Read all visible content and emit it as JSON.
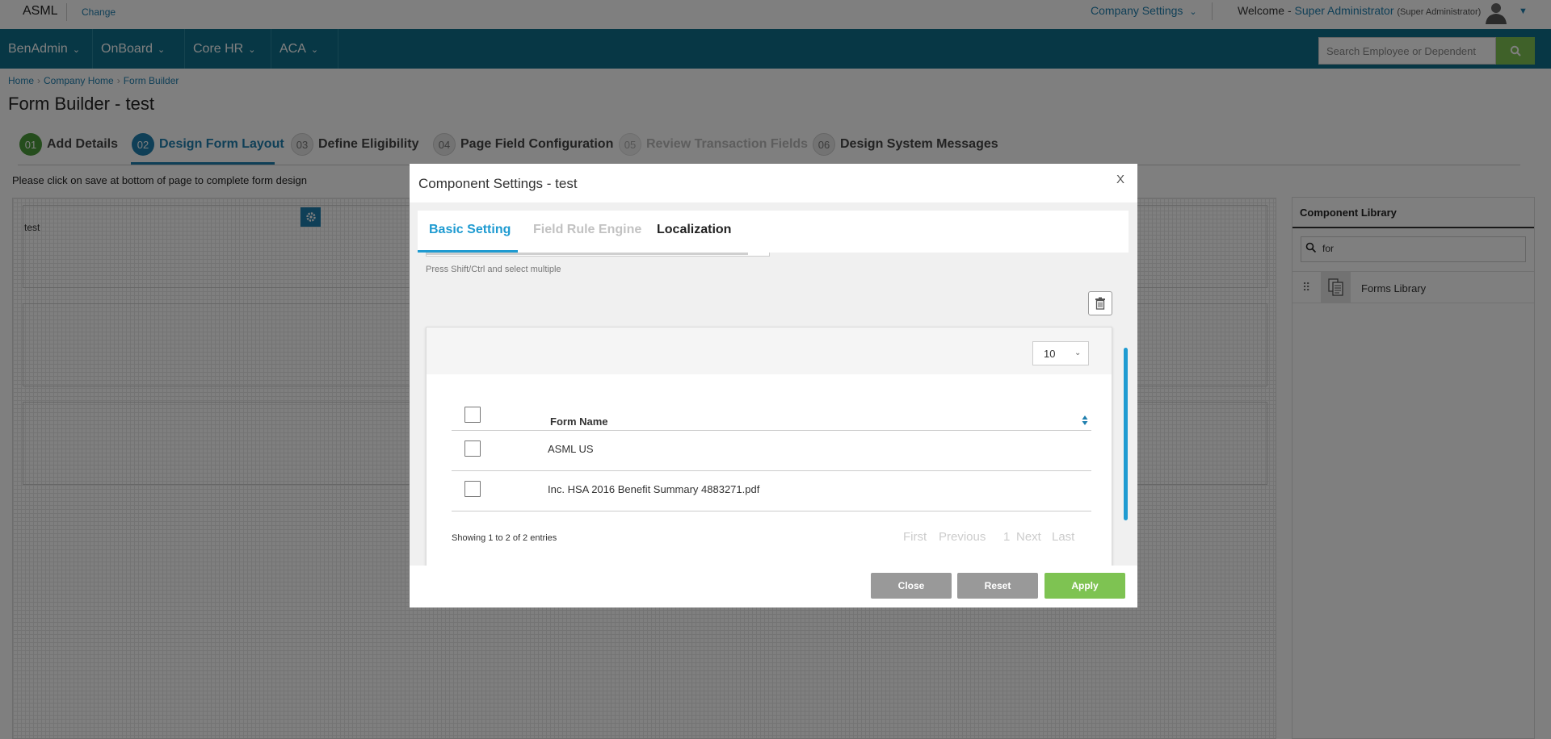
{
  "topbar": {
    "brand": "ASML",
    "change_link": "Change",
    "company_settings": "Company Settings",
    "welcome_prefix": "Welcome -",
    "user_name": "Super Administrator",
    "user_role": "(Super Administrator)"
  },
  "nav": {
    "items": [
      {
        "label": "BenAdmin"
      },
      {
        "label": "OnBoard"
      },
      {
        "label": "Core HR"
      },
      {
        "label": "ACA"
      }
    ],
    "search_placeholder": "Search Employee or Dependent"
  },
  "breadcrumb": [
    "Home",
    "Company Home",
    "Form Builder"
  ],
  "page_title": "Form Builder - test",
  "wizard": {
    "steps": [
      {
        "num": "01",
        "label": "Add Details",
        "state": "done"
      },
      {
        "num": "02",
        "label": "Design Form Layout",
        "state": "active"
      },
      {
        "num": "03",
        "label": "Define Eligibility",
        "state": "todo"
      },
      {
        "num": "04",
        "label": "Page Field Configuration",
        "state": "todo"
      },
      {
        "num": "05",
        "label": "Review Transaction Fields",
        "state": "disabled"
      },
      {
        "num": "06",
        "label": "Design System Messages",
        "state": "todo"
      }
    ]
  },
  "save_note": "Please click on save at bottom of page to complete form design",
  "canvas": {
    "field_label": "test"
  },
  "library": {
    "header": "Component Library",
    "search_value": "for",
    "item_label": "Forms Library"
  },
  "modal": {
    "title": "Component Settings - test",
    "close_x": "X",
    "tabs": [
      {
        "label": "Basic Setting",
        "state": "active"
      },
      {
        "label": "Field Rule Engine",
        "state": "disabled"
      },
      {
        "label": "Localization",
        "state": "normal"
      }
    ],
    "hint": "Press Shift/Ctrl and select multiple",
    "page_size": "10",
    "table": {
      "header": "Form Name",
      "rows": [
        "ASML US",
        "Inc. HSA 2016 Benefit Summary 4883271.pdf"
      ]
    },
    "showing": "Showing 1 to 2 of 2 entries",
    "pager": {
      "first": "First",
      "previous": "Previous",
      "page": "1",
      "next": "Next",
      "last": "Last"
    },
    "buttons": {
      "close": "Close",
      "reset": "Reset",
      "apply": "Apply"
    }
  },
  "colors": {
    "nav_bg": "#0f6f8a",
    "accent_blue": "#1f7fae",
    "tab_active": "#1f9bd1",
    "apply_green": "#7ec352",
    "step_done_green": "#4b9a3b"
  }
}
